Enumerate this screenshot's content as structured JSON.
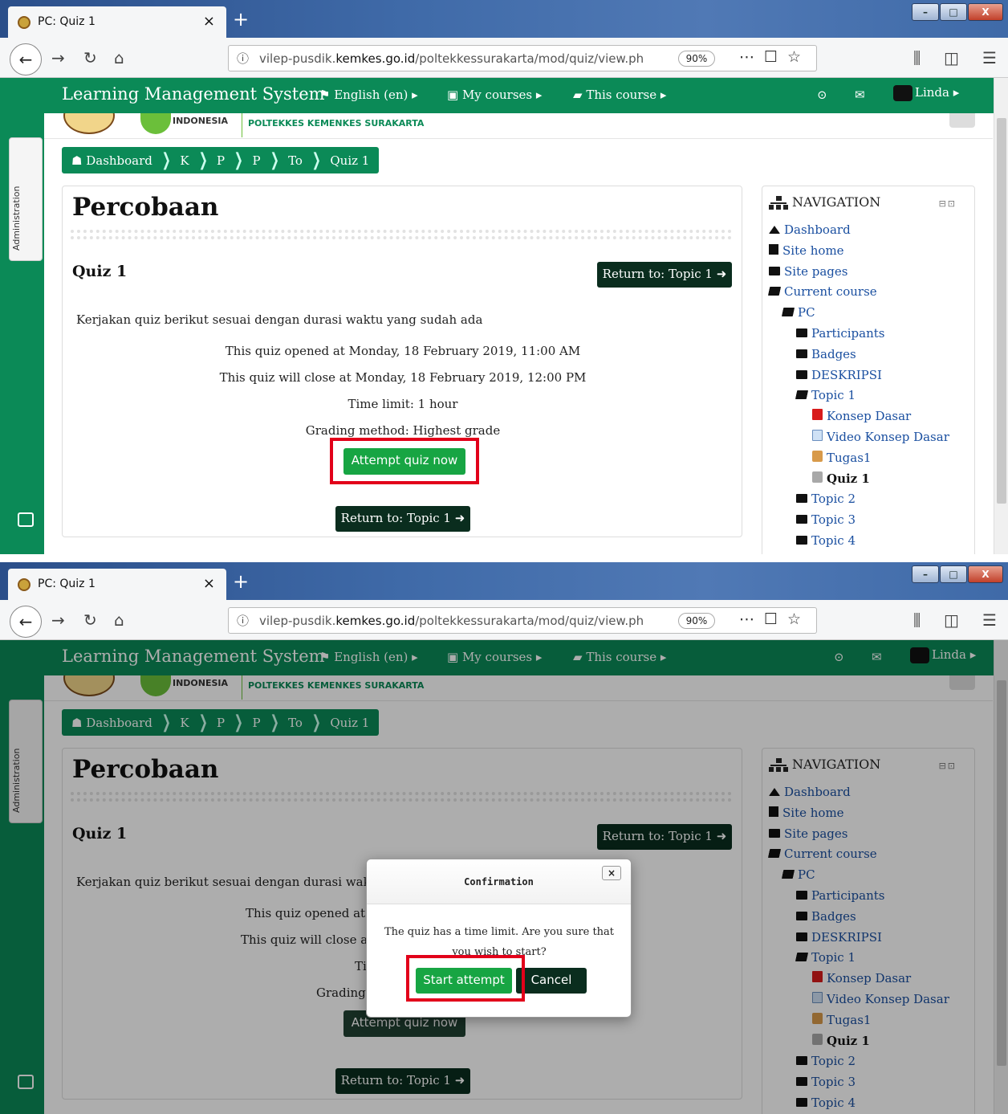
{
  "browser": {
    "tab_title": "PC: Quiz 1",
    "tab_close": "×",
    "new_tab": "+",
    "url_prefix": "vilep-pusdik.",
    "url_domain": "kemkes.go.id",
    "url_path": "/poltekkessurakarta/mod/quiz/view.ph",
    "zoom": "90%",
    "win_min": "–",
    "win_max": "□",
    "win_close": "X"
  },
  "header": {
    "brand": "Learning Management System",
    "language": "English (en)",
    "my_courses": "My courses",
    "this_course": "This course",
    "user": "Linda"
  },
  "banner": {
    "line1": "INDONESIA",
    "line2": "POLTEKKES KEMENKES SURAKARTA"
  },
  "drawer": {
    "admin_label": "Administration"
  },
  "breadcrumb": [
    "Dashboard",
    "K",
    "P",
    "P",
    "To",
    "Quiz 1"
  ],
  "page": {
    "title": "Percobaan",
    "quiz_title": "Quiz 1",
    "return_button": "Return to: Topic 1",
    "intro": "Kerjakan quiz berikut sesuai dengan durasi waktu yang sudah ada",
    "opened": "This quiz opened at Monday, 18 February 2019, 11:00 AM",
    "closes": "This quiz will close at Monday, 18 February 2019, 12:00 PM",
    "time_limit": "Time limit: 1 hour",
    "grading": "Grading method: Highest grade",
    "attempt_button": "Attempt quiz now"
  },
  "navigation": {
    "title": "NAVIGATION",
    "items": [
      {
        "label": "Dashboard",
        "icon": "home-icon"
      },
      {
        "label": "Site home",
        "icon": "file-icon"
      },
      {
        "label": "Site pages",
        "icon": "folder-icon"
      },
      {
        "label": "Current course",
        "icon": "folder-open-icon"
      },
      {
        "label": "PC",
        "icon": "folder-open-icon"
      },
      {
        "label": "Participants",
        "icon": "folder-icon"
      },
      {
        "label": "Badges",
        "icon": "folder-icon"
      },
      {
        "label": "DESKRIPSI",
        "icon": "folder-icon"
      },
      {
        "label": "Topic 1",
        "icon": "folder-open-icon"
      },
      {
        "label": "Konsep Dasar",
        "icon": "pdf-icon"
      },
      {
        "label": "Video Konsep Dasar",
        "icon": "page-icon"
      },
      {
        "label": "Tugas1",
        "icon": "assignment-icon"
      },
      {
        "label": "Quiz 1",
        "icon": "quiz-icon"
      },
      {
        "label": "Topic 2",
        "icon": "folder-icon"
      },
      {
        "label": "Topic 3",
        "icon": "folder-icon"
      },
      {
        "label": "Topic 4",
        "icon": "folder-icon"
      }
    ]
  },
  "modal": {
    "title": "Confirmation",
    "close": "×",
    "message": "The quiz has a time limit. Are you sure that you wish to start?",
    "start": "Start attempt",
    "cancel": "Cancel"
  },
  "page_partial": {
    "intro": "Kerjakan quiz berikut sesuai dengan durasi waktu yar",
    "opened": "This quiz opened at M",
    "closes": "This quiz will close at M",
    "time_limit": "Ti",
    "grading": "Grading"
  },
  "colors": {
    "brand_green": "#0b8a57",
    "button_green": "#17a543",
    "button_dark": "#0a2d1e",
    "highlight_red": "#e2001a"
  }
}
